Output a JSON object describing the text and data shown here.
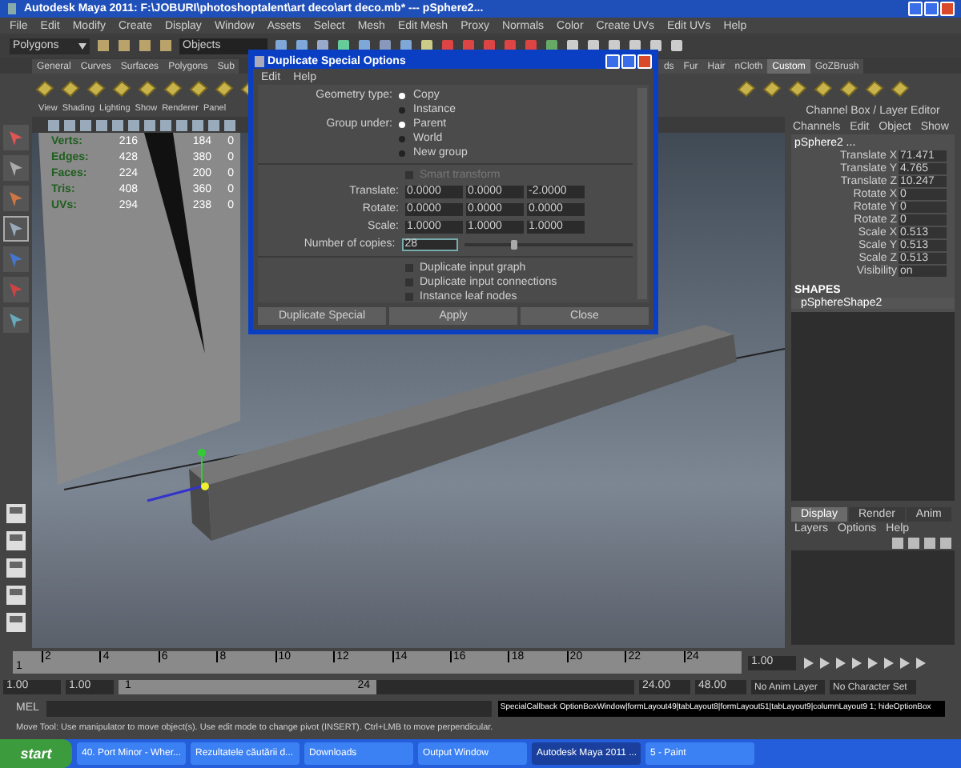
{
  "window": {
    "title": "Autodesk Maya 2011: F:\\JOBURI\\photoshoptalent\\art deco\\art deco.mb*   ---   pSphere2..."
  },
  "menu": [
    "File",
    "Edit",
    "Modify",
    "Create",
    "Display",
    "Window",
    "Assets",
    "Select",
    "Mesh",
    "Edit Mesh",
    "Proxy",
    "Normals",
    "Color",
    "Create UVs",
    "Edit UVs",
    "Help"
  ],
  "status_line": {
    "menu_set": "Polygons",
    "selection_field": "Objects"
  },
  "shelf_tabs": [
    {
      "label": "General",
      "selected": false
    },
    {
      "label": "Curves",
      "selected": false
    },
    {
      "label": "Surfaces",
      "selected": false
    },
    {
      "label": "Polygons",
      "selected": false
    },
    {
      "label": "Sub",
      "selected": false
    }
  ],
  "shelf_tabs_right": [
    {
      "label": "ds",
      "selected": false
    },
    {
      "label": "Fur",
      "selected": false
    },
    {
      "label": "Hair",
      "selected": false
    },
    {
      "label": "nCloth",
      "selected": false
    },
    {
      "label": "Custom",
      "selected": true
    },
    {
      "label": "GoZBrush",
      "selected": false
    }
  ],
  "viewport": {
    "panel_menu": [
      "View",
      "Shading",
      "Lighting",
      "Show",
      "Renderer",
      "Panel"
    ],
    "hud": [
      {
        "label": "Verts:",
        "values": [
          "216",
          "184",
          "0"
        ]
      },
      {
        "label": "Edges:",
        "values": [
          "428",
          "380",
          "0"
        ]
      },
      {
        "label": "Faces:",
        "values": [
          "224",
          "200",
          "0"
        ]
      },
      {
        "label": "Tris:",
        "values": [
          "408",
          "360",
          "0"
        ]
      },
      {
        "label": "UVs:",
        "values": [
          "294",
          "238",
          "0"
        ]
      }
    ]
  },
  "dialog": {
    "title": "Duplicate Special Options",
    "menu": [
      "Edit",
      "Help"
    ],
    "radio_groups": [
      {
        "label": "Geometry type:",
        "options": [
          {
            "label": "Copy",
            "selected": true
          },
          {
            "label": "Instance",
            "selected": false
          }
        ]
      },
      {
        "label": "Group under:",
        "options": [
          {
            "label": "Parent",
            "selected": true
          },
          {
            "label": "World",
            "selected": false
          },
          {
            "label": "New group",
            "selected": false
          }
        ]
      }
    ],
    "smart_transform": {
      "label": "Smart transform",
      "checked": false,
      "disabled": true
    },
    "vectors": [
      {
        "label": "Translate:",
        "values": [
          "0.0000",
          "0.0000",
          "-2.0000"
        ]
      },
      {
        "label": "Rotate:",
        "values": [
          "0.0000",
          "0.0000",
          "0.0000"
        ]
      },
      {
        "label": "Scale:",
        "values": [
          "1.0000",
          "1.0000",
          "1.0000"
        ]
      }
    ],
    "copies": {
      "label": "Number of copies:",
      "value": "28",
      "level": 0.28
    },
    "checkboxes": [
      {
        "label": "Duplicate input graph",
        "checked": false
      },
      {
        "label": "Duplicate input connections",
        "checked": false
      },
      {
        "label": "Instance leaf nodes",
        "checked": false
      }
    ],
    "buttons": [
      "Duplicate Special",
      "Apply",
      "Close"
    ]
  },
  "channel_box": {
    "header": "Channel Box / Layer Editor",
    "menu": [
      "Channels",
      "Edit",
      "Object",
      "Show"
    ],
    "object": "pSphere2 ...",
    "channels": [
      {
        "name": "Translate X",
        "value": "71.471"
      },
      {
        "name": "Translate Y",
        "value": "4.765"
      },
      {
        "name": "Translate Z",
        "value": "10.247"
      },
      {
        "name": "Rotate X",
        "value": "0"
      },
      {
        "name": "Rotate Y",
        "value": "0"
      },
      {
        "name": "Rotate Z",
        "value": "0"
      },
      {
        "name": "Scale X",
        "value": "0.513"
      },
      {
        "name": "Scale Y",
        "value": "0.513"
      },
      {
        "name": "Scale Z",
        "value": "0.513"
      },
      {
        "name": "Visibility",
        "value": "on"
      }
    ],
    "shapes_heading": "SHAPES",
    "shape": "pSphereShape2"
  },
  "layer_editor": {
    "tabs": [
      {
        "label": "Display",
        "selected": true
      },
      {
        "label": "Render",
        "selected": false
      },
      {
        "label": "Anim",
        "selected": false
      }
    ],
    "menu": [
      "Layers",
      "Options",
      "Help"
    ]
  },
  "timeline": {
    "ticks": [
      "2",
      "4",
      "6",
      "8",
      "10",
      "12",
      "14",
      "16",
      "18",
      "20",
      "22",
      "24"
    ],
    "current": "1",
    "current_field": "1.00"
  },
  "range": {
    "level": 0.5,
    "start": "1.00",
    "playback_start": "1.00",
    "slider_start": "1",
    "slider_end": "24",
    "playback_end": "24.00",
    "end": "48.00",
    "anim_layer": "No Anim Layer",
    "character_set": "No Character Set"
  },
  "command_line": {
    "label": "MEL",
    "output": "SpecialCallback OptionBoxWindow|formLayout49|tabLayout8|formLayout51|tabLayout9|columnLayout9 1; hideOptionBox"
  },
  "help_line": "Move Tool: Use manipulator to move object(s). Use edit mode to change pivot (INSERT).  Ctrl+LMB to move perpendicular.",
  "taskbar": {
    "start": "start",
    "items": [
      {
        "label": "40. Port Minor - Wher...",
        "active": false
      },
      {
        "label": "Rezultatele căutării d...",
        "active": false
      },
      {
        "label": "Downloads",
        "active": false
      },
      {
        "label": "Output Window",
        "active": false
      },
      {
        "label": "Autodesk Maya 2011 ...",
        "active": true
      },
      {
        "label": "5 - Paint",
        "active": false
      }
    ]
  }
}
